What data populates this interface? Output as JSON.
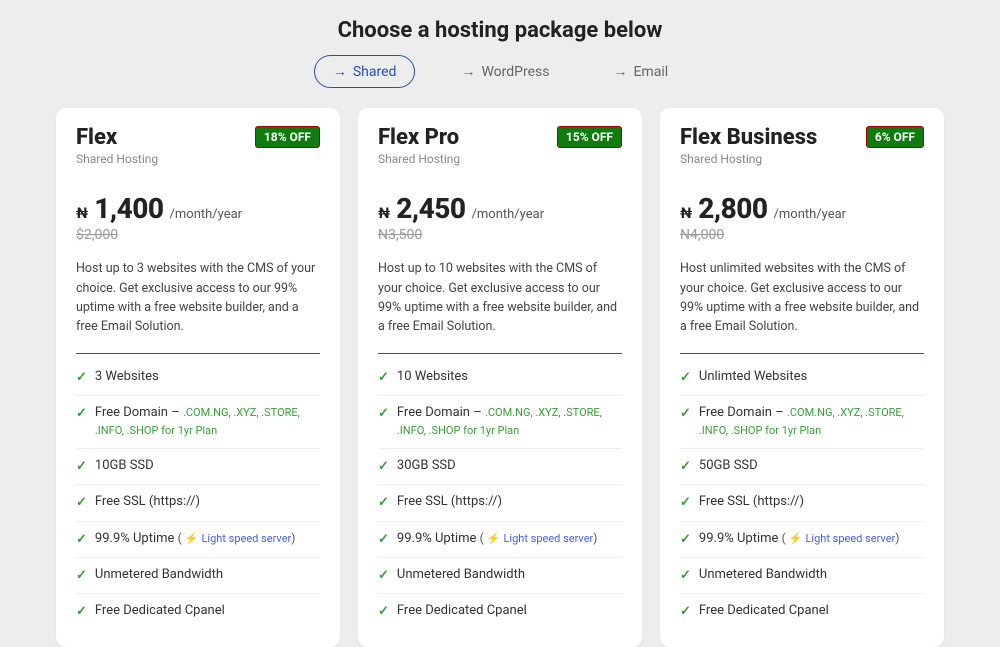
{
  "title": "Choose a hosting package below",
  "tabs": [
    {
      "label": "Shared",
      "active": true
    },
    {
      "label": "WordPress",
      "active": false
    },
    {
      "label": "Email",
      "active": false
    }
  ],
  "currency": "₦",
  "period": "/month/year",
  "plans": [
    {
      "name": "Flex",
      "subtitle": "Shared Hosting",
      "badge": "18% OFF",
      "price": "1,400",
      "old_price": "$2,000",
      "desc": "Host up to 3 websites with the CMS of your choice. Get exclusive access to our 99% uptime with a free website builder, and a free Email Solution.",
      "websites": "3 Websites",
      "domain_label": "Free Domain – ",
      "domain_ext": ".COM.NG, .XYZ, .STORE, .INFO, .SHOP for 1yr Plan",
      "ssd": "10GB SSD",
      "ssl": "Free SSL (https://)",
      "uptime": "99.9% Uptime",
      "uptime_note": "Light speed server",
      "bandwidth": "Unmetered Bandwidth",
      "cpanel": "Free Dedicated Cpanel"
    },
    {
      "name": "Flex Pro",
      "subtitle": "Shared Hosting",
      "badge": "15% OFF",
      "price": "2,450",
      "old_price": "N3,500",
      "desc": "Host up to 10 websites with the CMS of your choice. Get exclusive access to our 99% uptime with a free website builder, and a free Email Solution.",
      "websites": "10 Websites",
      "domain_label": "Free Domain – ",
      "domain_ext": ".COM.NG, .XYZ, .STORE, .INFO, .SHOP for 1yr Plan",
      "ssd": "30GB SSD",
      "ssl": "Free SSL (https://)",
      "uptime": "99.9% Uptime",
      "uptime_note": "Light speed server",
      "bandwidth": "Unmetered Bandwidth",
      "cpanel": "Free Dedicated Cpanel"
    },
    {
      "name": "Flex Business",
      "subtitle": "Shared Hosting",
      "badge": "6% OFF",
      "price": "2,800",
      "old_price": "N4,000",
      "desc": "Host unlimited websites with the CMS of your choice. Get exclusive access to our 99% uptime with a free website builder, and a free Email Solution.",
      "websites": "Unlimted Websites",
      "domain_label": "Free Domain – ",
      "domain_ext": ".COM.NG, .XYZ, .STORE, .INFO, .SHOP for 1yr Plan",
      "ssd": "50GB SSD",
      "ssl": "Free SSL (https://)",
      "uptime": "99.9% Uptime",
      "uptime_note": "Light speed server",
      "bandwidth": "Unmetered Bandwidth",
      "cpanel": "Free Dedicated Cpanel"
    }
  ]
}
